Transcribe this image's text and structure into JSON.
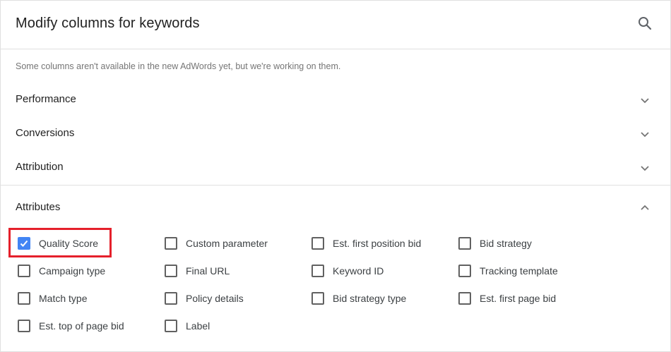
{
  "header": {
    "title": "Modify columns for keywords",
    "search_icon": "search-icon"
  },
  "notice": "Some columns aren't available in the new AdWords yet, but we're working on them.",
  "sections": [
    {
      "label": "Performance",
      "expanded": false
    },
    {
      "label": "Conversions",
      "expanded": false
    },
    {
      "label": "Attribution",
      "expanded": false
    },
    {
      "label": "Attributes",
      "expanded": true
    }
  ],
  "attributes": [
    [
      {
        "label": "Quality Score",
        "checked": true
      },
      {
        "label": "Campaign type",
        "checked": false
      },
      {
        "label": "Match type",
        "checked": false
      },
      {
        "label": "Est. top of page bid",
        "checked": false
      }
    ],
    [
      {
        "label": "Custom parameter",
        "checked": false
      },
      {
        "label": "Final URL",
        "checked": false
      },
      {
        "label": "Policy details",
        "checked": false
      },
      {
        "label": "Label",
        "checked": false
      }
    ],
    [
      {
        "label": "Est. first position bid",
        "checked": false
      },
      {
        "label": "Keyword ID",
        "checked": false
      },
      {
        "label": "Bid strategy type",
        "checked": false
      }
    ],
    [
      {
        "label": "Bid strategy",
        "checked": false
      },
      {
        "label": "Tracking template",
        "checked": false
      },
      {
        "label": "Est. first page bid",
        "checked": false
      }
    ]
  ],
  "colors": {
    "checkbox_checked": "#4285f4",
    "highlight": "#e5202b",
    "divider": "#e0e0e0"
  }
}
